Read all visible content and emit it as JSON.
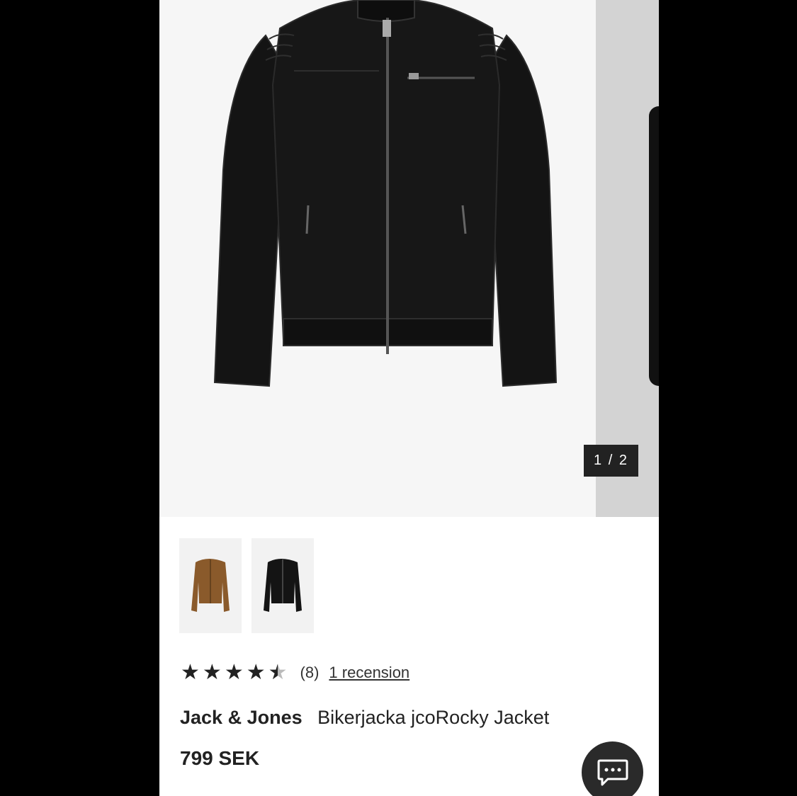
{
  "gallery": {
    "counter": "1 / 2",
    "current_image": "black-biker-jacket",
    "thumbnails": [
      {
        "name": "brown-jacket-thumbnail",
        "color": "#8a5a2b"
      },
      {
        "name": "black-jacket-thumbnail",
        "color": "#141414"
      }
    ]
  },
  "product": {
    "rating": 4.5,
    "rating_count": "(8)",
    "reviews_link": "1 recension",
    "brand": "Jack & Jones",
    "name": "Bikerjacka jcoRocky Jacket",
    "price": "799 SEK"
  },
  "chat": {
    "icon": "chat-bubble-icon"
  }
}
